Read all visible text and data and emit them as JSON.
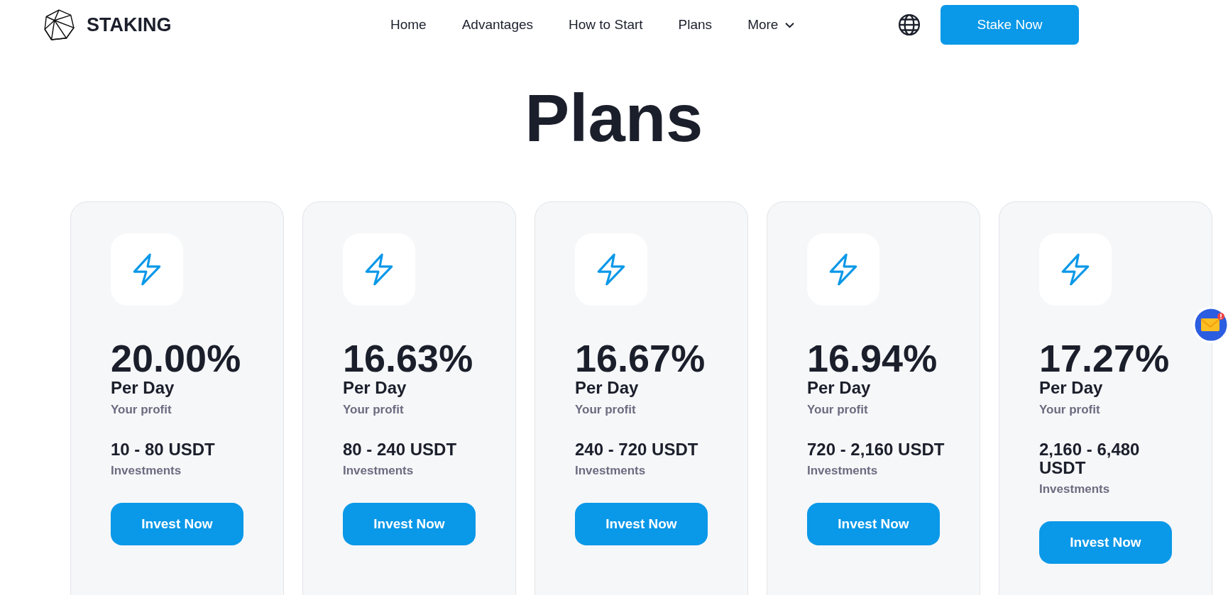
{
  "header": {
    "brand": "STAKING",
    "nav": [
      {
        "label": "Home",
        "kind": "link"
      },
      {
        "label": "Advantages",
        "kind": "link"
      },
      {
        "label": "How to Start",
        "kind": "link"
      },
      {
        "label": "Plans",
        "kind": "link"
      },
      {
        "label": "More",
        "kind": "dropdown"
      }
    ],
    "cta": "Stake Now"
  },
  "title": "Plans",
  "plans": [
    {
      "rate": "20.00%",
      "period": "Per Day",
      "rate_label": "Your profit",
      "range": "10 - 80 USDT",
      "range_label": "Investments",
      "button": "Invest Now"
    },
    {
      "rate": "16.63%",
      "period": "Per Day",
      "rate_label": "Your profit",
      "range": "80 - 240 USDT",
      "range_label": "Investments",
      "button": "Invest Now"
    },
    {
      "rate": "16.67%",
      "period": "Per Day",
      "rate_label": "Your profit",
      "range": "240 - 720 USDT",
      "range_label": "Investments",
      "button": "Invest Now"
    },
    {
      "rate": "16.94%",
      "period": "Per Day",
      "rate_label": "Your profit",
      "range": "720 - 2,160 USDT",
      "range_label": "Investments",
      "button": "Invest Now"
    },
    {
      "rate": "17.27%",
      "period": "Per Day",
      "rate_label": "Your profit",
      "range": "2,160 - 6,480 USDT",
      "range_label": "Investments",
      "button": "Invest Now"
    }
  ]
}
